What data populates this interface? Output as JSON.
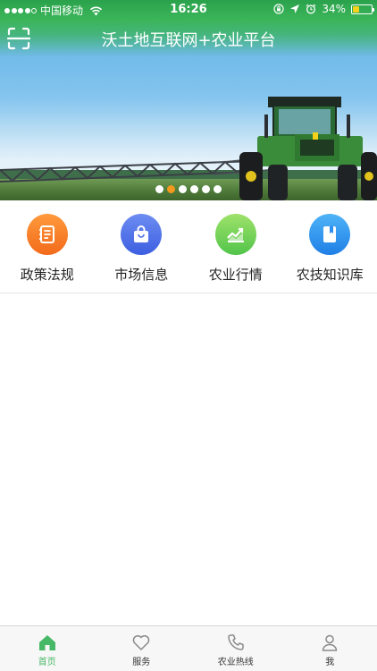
{
  "status_bar": {
    "carrier": "中国移动",
    "time": "16:26",
    "battery": "34%",
    "battery_level": 0.34,
    "signal_bars": 4
  },
  "header": {
    "title": "沃土地互联网+农业平台",
    "scan_icon": "scan-icon"
  },
  "carousel": {
    "slide_count": 6,
    "active_index": 1,
    "active_color": "#f39a1e"
  },
  "quick_menu": [
    {
      "label": "政策法规",
      "icon": "policy-book-icon",
      "color_from": "#ff9a3c",
      "color_to": "#f26a1b"
    },
    {
      "label": "市场信息",
      "icon": "shopping-bag-icon",
      "color_from": "#6d8cf2",
      "color_to": "#3d5fe0"
    },
    {
      "label": "农业行情",
      "icon": "trend-chart-icon",
      "color_from": "#9ee26a",
      "color_to": "#52c44a"
    },
    {
      "label": "农技知识库",
      "icon": "bookmark-book-icon",
      "color_from": "#4fb3f7",
      "color_to": "#1f7fe6"
    }
  ],
  "tabbar": [
    {
      "label": "首页",
      "icon": "home-icon",
      "active": true
    },
    {
      "label": "服务",
      "icon": "heart-icon",
      "active": false
    },
    {
      "label": "农业热线",
      "icon": "phone-icon",
      "active": false
    },
    {
      "label": "我",
      "icon": "person-icon",
      "active": false
    }
  ],
  "colors": {
    "brand_green": "#3bb55a",
    "tab_active": "#47b866",
    "tab_inactive": "#8a8a8a"
  }
}
